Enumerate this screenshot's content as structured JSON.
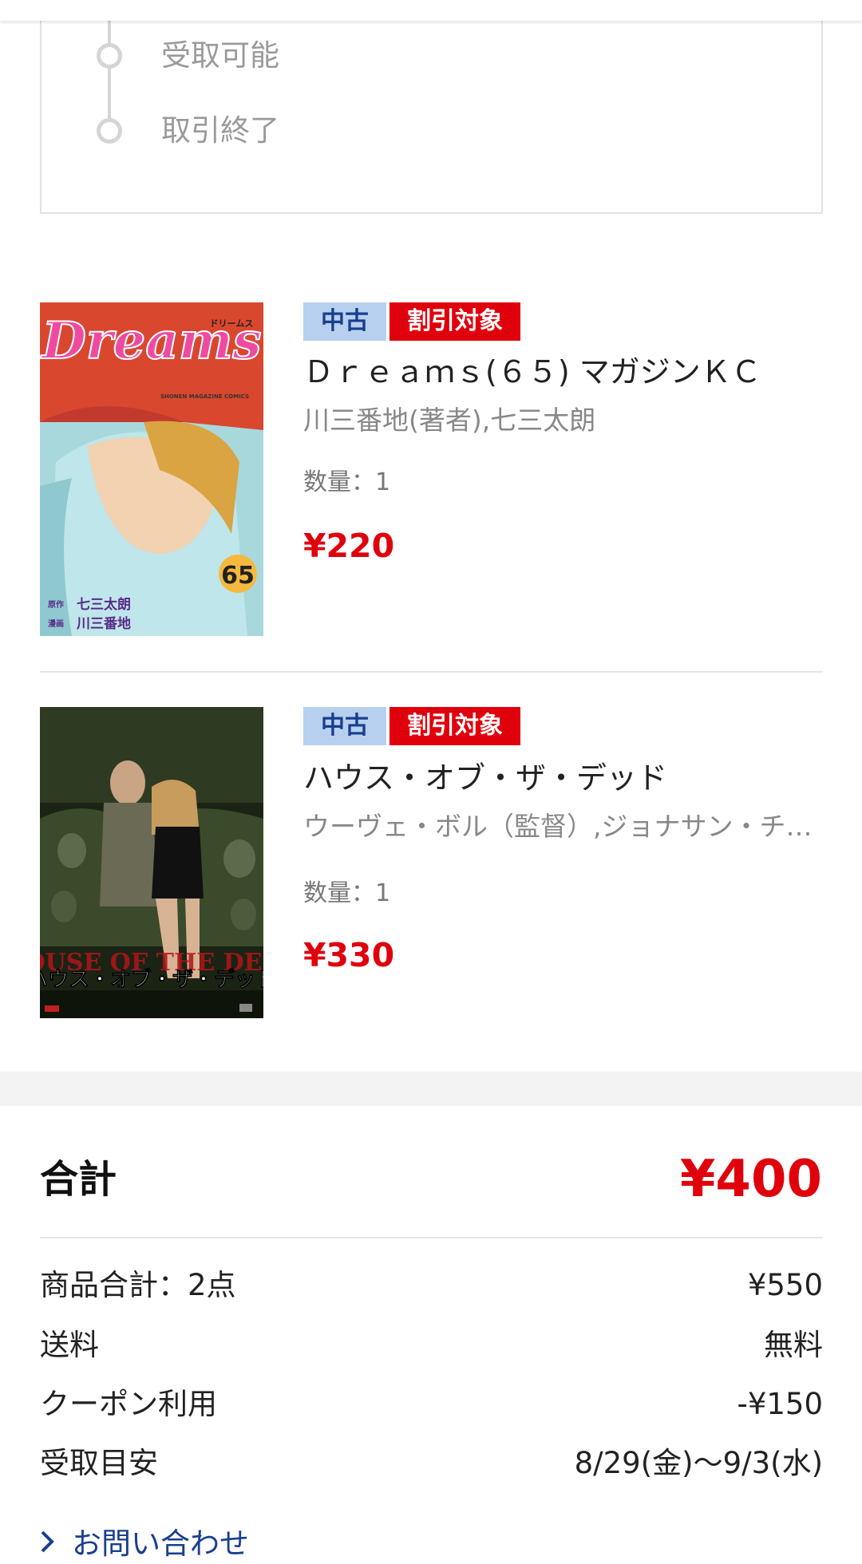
{
  "timeline": {
    "steps": [
      {
        "label": "受取可能"
      },
      {
        "label": "取引終了"
      }
    ]
  },
  "items": [
    {
      "badge_condition": "中古",
      "badge_sale": "割引対象",
      "title": "Ｄｒｅａｍｓ(６５) マガジンＫＣ",
      "author": "川三番地(著者),七三太朗",
      "quantity": "数量：1",
      "price": "¥220",
      "cover": {
        "logo": "Dreams",
        "kana": "ドリームス",
        "imprint": "SHONEN MAGAZINE COMICS",
        "volume": "65",
        "credit_story_role": "原作",
        "credit_story": "七三太朗",
        "credit_art_role": "漫画",
        "credit_art": "川三番地"
      }
    },
    {
      "badge_condition": "中古",
      "badge_sale": "割引対象",
      "title": "ハウス・オブ・ザ・デッド",
      "author": "ウーヴェ・ボル（監督）,ジョナサン・チェリー,タイロン・レイツォ,クリント・ハワード",
      "quantity": "数量：1",
      "price": "¥330",
      "cover": {
        "title_en": "HOUSE OF THE DEAD",
        "title_ja": "ハウス・オブ・ザ・デッド"
      }
    }
  ],
  "summary": {
    "total_label": "合計",
    "total_value": "¥400",
    "rows": [
      {
        "label": "商品合計：2点",
        "value": "¥550"
      },
      {
        "label": "送料",
        "value": "無料"
      },
      {
        "label": "クーポン利用",
        "value": "-¥150"
      },
      {
        "label": "受取目安",
        "value": "8/29(金)〜9/3(水)"
      }
    ]
  },
  "contact": {
    "label": "お問い合わせ"
  },
  "colors": {
    "price_red": "#e0000c",
    "badge_blue_bg": "#b8d0f0",
    "badge_blue_text": "#1a3f8f",
    "link_blue": "#1a3f8f"
  }
}
